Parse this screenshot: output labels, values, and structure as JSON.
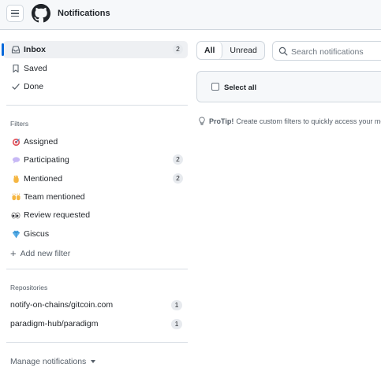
{
  "header": {
    "title": "Notifications"
  },
  "sidebar": {
    "items": [
      {
        "label": "Inbox",
        "icon": "inbox-icon",
        "count": "2",
        "active": true
      },
      {
        "label": "Saved",
        "icon": "bookmark-icon"
      },
      {
        "label": "Done",
        "icon": "check-icon"
      }
    ],
    "filters_title": "Filters",
    "filters": [
      {
        "label": "Assigned",
        "icon": "dart-emoji-icon"
      },
      {
        "label": "Participating",
        "icon": "speech-balloon-emoji-icon",
        "count": "2"
      },
      {
        "label": "Mentioned",
        "icon": "raised-hand-emoji-icon",
        "count": "2"
      },
      {
        "label": "Team mentioned",
        "icon": "raising-hands-emoji-icon"
      },
      {
        "label": "Review requested",
        "icon": "eyes-emoji-icon"
      },
      {
        "label": "Giscus",
        "icon": "gem-emoji-icon"
      }
    ],
    "add_filter": "Add new filter",
    "repos_title": "Repositories",
    "repos": [
      {
        "label": "notify-on-chains/gitcoin.com",
        "count": "1"
      },
      {
        "label": "paradigm-hub/paradigm",
        "count": "1"
      }
    ],
    "manage": "Manage notifications"
  },
  "main": {
    "tabs": [
      {
        "label": "All",
        "selected": true
      },
      {
        "label": "Unread"
      }
    ],
    "search_placeholder": "Search notifications",
    "select_all": "Select all",
    "protip_label": "ProTip!",
    "protip_text": "Create custom filters to quickly access your most"
  },
  "colors": {
    "accent": "#0969da",
    "text": "#1f2328",
    "muted": "#57606a",
    "border": "#d0d7de"
  }
}
